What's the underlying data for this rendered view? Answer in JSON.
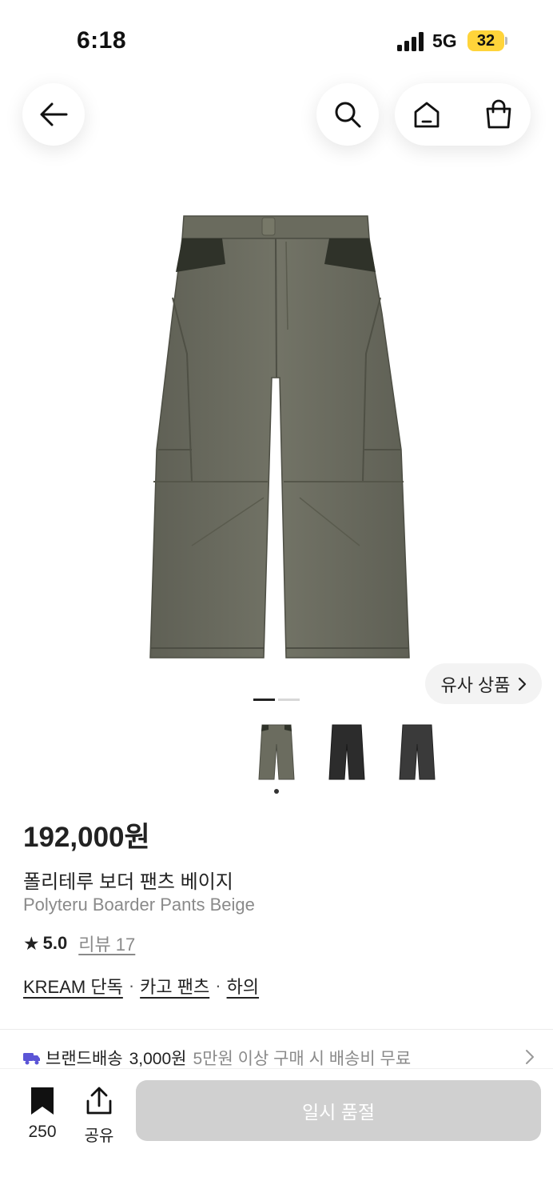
{
  "status_bar": {
    "time": "6:18",
    "network": "5G",
    "battery": "32"
  },
  "nav": {
    "back_icon": "arrow-left-icon",
    "search_icon": "search-icon",
    "home_icon": "home-icon",
    "cart_icon": "shopping-bag-icon"
  },
  "gallery": {
    "similar_label": "유사 상품",
    "similar_icon": "chevron-right-icon",
    "active_page": 1,
    "page_count": 2,
    "thumbnail_colors": [
      "#6b6c5f",
      "#2c2c2c",
      "#3a3a3a"
    ],
    "selected_thumbnail": 0
  },
  "product": {
    "price": "192,000원",
    "name_ko": "폴리테루 보더 팬츠 베이지",
    "name_en": "Polyteru Boarder Pants Beige",
    "rating": "5.0",
    "review_label": "리뷰 17",
    "tags": [
      "KREAM 단독",
      "카고 팬츠",
      "하의"
    ]
  },
  "shipping": {
    "label": "브랜드배송",
    "fee": "3,000원",
    "note": "5만원 이상 구매 시 배송비 무료"
  },
  "bottom_bar": {
    "bookmark_count": "250",
    "share_label": "공유",
    "soldout_label": "일시 품절"
  },
  "colors": {
    "accent_battery": "#ffd43a",
    "shipping_truck": "#5b55d6",
    "soldout_bg": "#d0d0d0"
  }
}
